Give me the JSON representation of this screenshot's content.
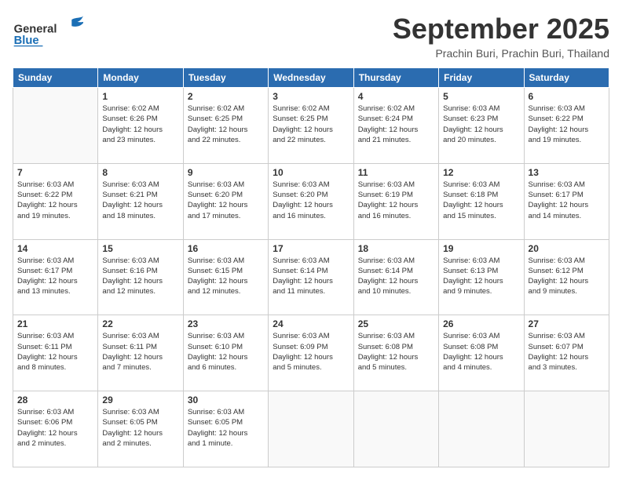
{
  "header": {
    "logo_general": "General",
    "logo_blue": "Blue",
    "month": "September 2025",
    "location": "Prachin Buri, Prachin Buri, Thailand"
  },
  "weekdays": [
    "Sunday",
    "Monday",
    "Tuesday",
    "Wednesday",
    "Thursday",
    "Friday",
    "Saturday"
  ],
  "weeks": [
    [
      {
        "day": "",
        "info": ""
      },
      {
        "day": "1",
        "info": "Sunrise: 6:02 AM\nSunset: 6:26 PM\nDaylight: 12 hours\nand 23 minutes."
      },
      {
        "day": "2",
        "info": "Sunrise: 6:02 AM\nSunset: 6:25 PM\nDaylight: 12 hours\nand 22 minutes."
      },
      {
        "day": "3",
        "info": "Sunrise: 6:02 AM\nSunset: 6:25 PM\nDaylight: 12 hours\nand 22 minutes."
      },
      {
        "day": "4",
        "info": "Sunrise: 6:02 AM\nSunset: 6:24 PM\nDaylight: 12 hours\nand 21 minutes."
      },
      {
        "day": "5",
        "info": "Sunrise: 6:03 AM\nSunset: 6:23 PM\nDaylight: 12 hours\nand 20 minutes."
      },
      {
        "day": "6",
        "info": "Sunrise: 6:03 AM\nSunset: 6:22 PM\nDaylight: 12 hours\nand 19 minutes."
      }
    ],
    [
      {
        "day": "7",
        "info": "Sunrise: 6:03 AM\nSunset: 6:22 PM\nDaylight: 12 hours\nand 19 minutes."
      },
      {
        "day": "8",
        "info": "Sunrise: 6:03 AM\nSunset: 6:21 PM\nDaylight: 12 hours\nand 18 minutes."
      },
      {
        "day": "9",
        "info": "Sunrise: 6:03 AM\nSunset: 6:20 PM\nDaylight: 12 hours\nand 17 minutes."
      },
      {
        "day": "10",
        "info": "Sunrise: 6:03 AM\nSunset: 6:20 PM\nDaylight: 12 hours\nand 16 minutes."
      },
      {
        "day": "11",
        "info": "Sunrise: 6:03 AM\nSunset: 6:19 PM\nDaylight: 12 hours\nand 16 minutes."
      },
      {
        "day": "12",
        "info": "Sunrise: 6:03 AM\nSunset: 6:18 PM\nDaylight: 12 hours\nand 15 minutes."
      },
      {
        "day": "13",
        "info": "Sunrise: 6:03 AM\nSunset: 6:17 PM\nDaylight: 12 hours\nand 14 minutes."
      }
    ],
    [
      {
        "day": "14",
        "info": "Sunrise: 6:03 AM\nSunset: 6:17 PM\nDaylight: 12 hours\nand 13 minutes."
      },
      {
        "day": "15",
        "info": "Sunrise: 6:03 AM\nSunset: 6:16 PM\nDaylight: 12 hours\nand 12 minutes."
      },
      {
        "day": "16",
        "info": "Sunrise: 6:03 AM\nSunset: 6:15 PM\nDaylight: 12 hours\nand 12 minutes."
      },
      {
        "day": "17",
        "info": "Sunrise: 6:03 AM\nSunset: 6:14 PM\nDaylight: 12 hours\nand 11 minutes."
      },
      {
        "day": "18",
        "info": "Sunrise: 6:03 AM\nSunset: 6:14 PM\nDaylight: 12 hours\nand 10 minutes."
      },
      {
        "day": "19",
        "info": "Sunrise: 6:03 AM\nSunset: 6:13 PM\nDaylight: 12 hours\nand 9 minutes."
      },
      {
        "day": "20",
        "info": "Sunrise: 6:03 AM\nSunset: 6:12 PM\nDaylight: 12 hours\nand 9 minutes."
      }
    ],
    [
      {
        "day": "21",
        "info": "Sunrise: 6:03 AM\nSunset: 6:11 PM\nDaylight: 12 hours\nand 8 minutes."
      },
      {
        "day": "22",
        "info": "Sunrise: 6:03 AM\nSunset: 6:11 PM\nDaylight: 12 hours\nand 7 minutes."
      },
      {
        "day": "23",
        "info": "Sunrise: 6:03 AM\nSunset: 6:10 PM\nDaylight: 12 hours\nand 6 minutes."
      },
      {
        "day": "24",
        "info": "Sunrise: 6:03 AM\nSunset: 6:09 PM\nDaylight: 12 hours\nand 5 minutes."
      },
      {
        "day": "25",
        "info": "Sunrise: 6:03 AM\nSunset: 6:08 PM\nDaylight: 12 hours\nand 5 minutes."
      },
      {
        "day": "26",
        "info": "Sunrise: 6:03 AM\nSunset: 6:08 PM\nDaylight: 12 hours\nand 4 minutes."
      },
      {
        "day": "27",
        "info": "Sunrise: 6:03 AM\nSunset: 6:07 PM\nDaylight: 12 hours\nand 3 minutes."
      }
    ],
    [
      {
        "day": "28",
        "info": "Sunrise: 6:03 AM\nSunset: 6:06 PM\nDaylight: 12 hours\nand 2 minutes."
      },
      {
        "day": "29",
        "info": "Sunrise: 6:03 AM\nSunset: 6:05 PM\nDaylight: 12 hours\nand 2 minutes."
      },
      {
        "day": "30",
        "info": "Sunrise: 6:03 AM\nSunset: 6:05 PM\nDaylight: 12 hours\nand 1 minute."
      },
      {
        "day": "",
        "info": ""
      },
      {
        "day": "",
        "info": ""
      },
      {
        "day": "",
        "info": ""
      },
      {
        "day": "",
        "info": ""
      }
    ]
  ]
}
